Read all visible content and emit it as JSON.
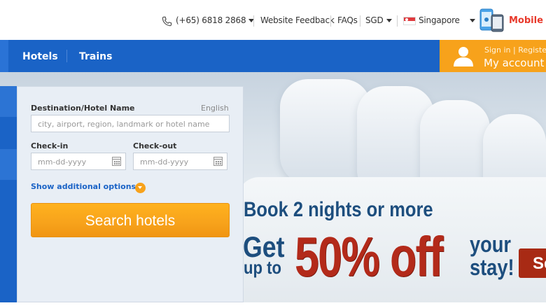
{
  "topbar": {
    "phone": "(+65) 6818 2868",
    "website_feedback": "Website Feedback",
    "faqs": "FAQs",
    "currency": "SGD",
    "country": "Singapore",
    "mobile_app": "Mobile A"
  },
  "nav": {
    "items": [
      {
        "label": "Hotels"
      },
      {
        "label": "Trains"
      }
    ]
  },
  "account": {
    "signin": "Sign in | Register",
    "title": "My account"
  },
  "search": {
    "destination_label": "Destination/Hotel Name",
    "language": "English",
    "destination_placeholder": "city, airport, region, landmark or hotel name",
    "checkin_label": "Check-in",
    "checkout_label": "Check-out",
    "checkin_placeholder": "mm-dd-yyyy",
    "checkout_placeholder": "mm-dd-yyyy",
    "more_options": "Show additional options",
    "button": "Search hotels"
  },
  "promo": {
    "line1": "Book 2 nights or more",
    "get": "Get",
    "upto": "up to",
    "percent": "50% off",
    "your": "your",
    "stay": "stay!",
    "see": "Se"
  },
  "colors": {
    "nav_blue": "#1a63c6",
    "accent_orange": "#f7a21b",
    "promo_red": "#b32a1a",
    "promo_navy": "#1d4e7e"
  }
}
